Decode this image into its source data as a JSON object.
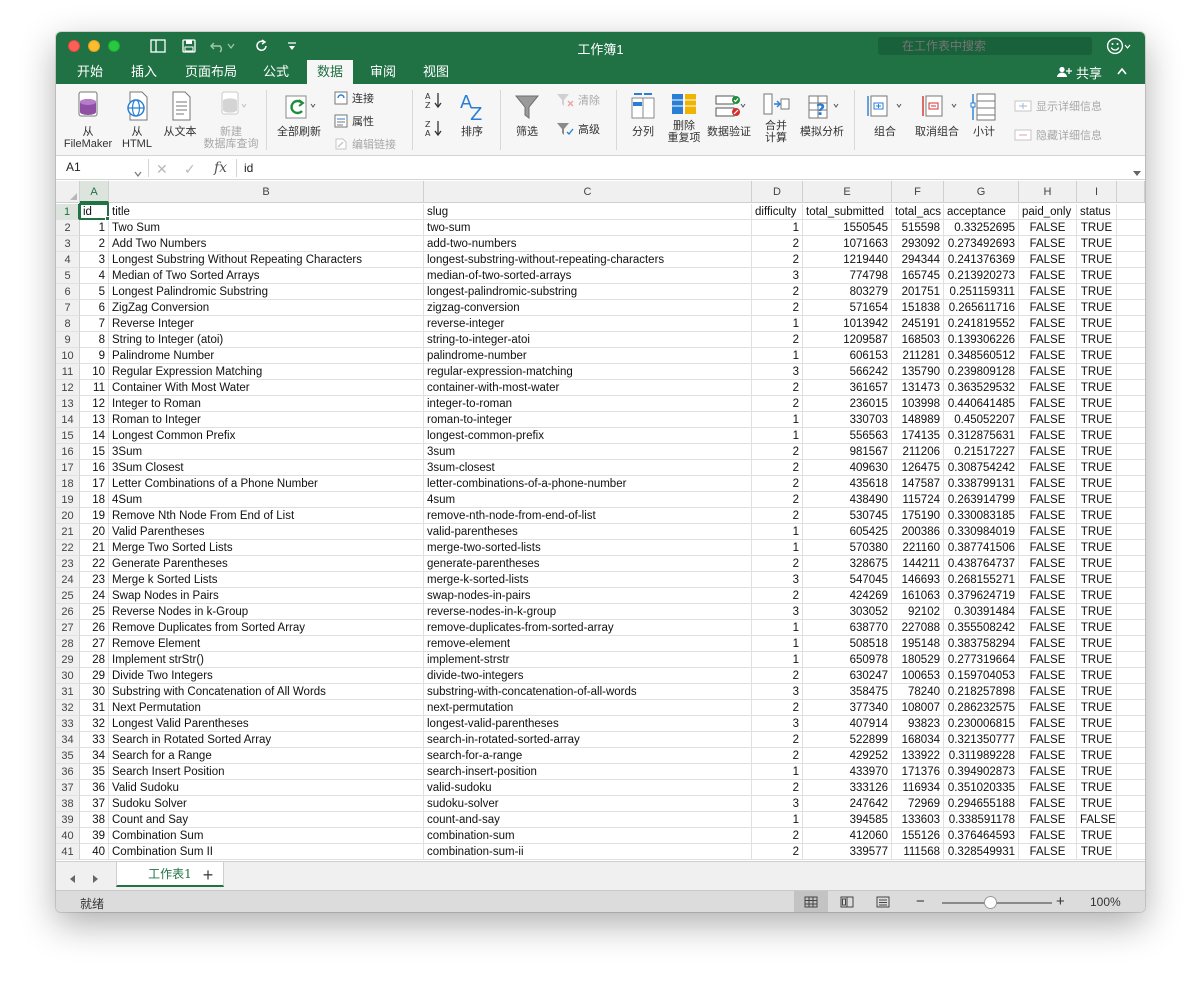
{
  "window": {
    "title": "工作簿1"
  },
  "search": {
    "placeholder": "在工作表中搜索"
  },
  "ribbon_tabs": [
    "开始",
    "插入",
    "页面布局",
    "公式",
    "数据",
    "审阅",
    "视图"
  ],
  "active_tab": "数据",
  "share_label": "共享",
  "ribbon": {
    "from_filemaker": "从\nFileMaker",
    "from_html": "从\nHTML",
    "from_text": "从文本",
    "new_db_query": "新建\n数据库查询",
    "refresh_all": "全部刷新",
    "connections": "连接",
    "properties": "属性",
    "edit_links": "编辑链接",
    "sort_az": "A↓Z",
    "sort_za": "Z↓A",
    "sort": "排序",
    "filter": "筛选",
    "clear": "清除",
    "advanced": "高级",
    "text_to_columns": "分列",
    "remove_duplicates": "删除\n重复项",
    "data_validation": "数据验证",
    "consolidate": "合并\n计算",
    "what_if": "模拟分析",
    "group": "组合",
    "ungroup": "取消组合",
    "subtotal": "小计",
    "show_detail": "显示详细信息",
    "hide_detail": "隐藏详细信息"
  },
  "formula_bar": {
    "name_box": "A1",
    "fx": "fx",
    "content": "id"
  },
  "columns": [
    {
      "letter": "A"
    },
    {
      "letter": "B"
    },
    {
      "letter": "C"
    },
    {
      "letter": "D"
    },
    {
      "letter": "E"
    },
    {
      "letter": "F"
    },
    {
      "letter": "G"
    },
    {
      "letter": "H"
    },
    {
      "letter": "I"
    }
  ],
  "header_row": [
    "id",
    "title",
    "slug",
    "difficulty",
    "total_submitted",
    "total_acs",
    "acceptance",
    "paid_only",
    "status"
  ],
  "rows": [
    [
      "1",
      "Two Sum",
      "two-sum",
      "1",
      "1550545",
      "515598",
      "0.33252695",
      "FALSE",
      "TRUE"
    ],
    [
      "2",
      "Add Two Numbers",
      "add-two-numbers",
      "2",
      "1071663",
      "293092",
      "0.273492693",
      "FALSE",
      "TRUE"
    ],
    [
      "3",
      "Longest Substring Without Repeating Characters",
      "longest-substring-without-repeating-characters",
      "2",
      "1219440",
      "294344",
      "0.241376369",
      "FALSE",
      "TRUE"
    ],
    [
      "4",
      "Median of Two Sorted Arrays",
      "median-of-two-sorted-arrays",
      "3",
      "774798",
      "165745",
      "0.213920273",
      "FALSE",
      "TRUE"
    ],
    [
      "5",
      "Longest Palindromic Substring",
      "longest-palindromic-substring",
      "2",
      "803279",
      "201751",
      "0.251159311",
      "FALSE",
      "TRUE"
    ],
    [
      "6",
      "ZigZag Conversion",
      "zigzag-conversion",
      "2",
      "571654",
      "151838",
      "0.265611716",
      "FALSE",
      "TRUE"
    ],
    [
      "7",
      "Reverse Integer",
      "reverse-integer",
      "1",
      "1013942",
      "245191",
      "0.241819552",
      "FALSE",
      "TRUE"
    ],
    [
      "8",
      "String to Integer (atoi)",
      "string-to-integer-atoi",
      "2",
      "1209587",
      "168503",
      "0.139306226",
      "FALSE",
      "TRUE"
    ],
    [
      "9",
      "Palindrome Number",
      "palindrome-number",
      "1",
      "606153",
      "211281",
      "0.348560512",
      "FALSE",
      "TRUE"
    ],
    [
      "10",
      "Regular Expression Matching",
      "regular-expression-matching",
      "3",
      "566242",
      "135790",
      "0.239809128",
      "FALSE",
      "TRUE"
    ],
    [
      "11",
      "Container With Most Water",
      "container-with-most-water",
      "2",
      "361657",
      "131473",
      "0.363529532",
      "FALSE",
      "TRUE"
    ],
    [
      "12",
      "Integer to Roman",
      "integer-to-roman",
      "2",
      "236015",
      "103998",
      "0.440641485",
      "FALSE",
      "TRUE"
    ],
    [
      "13",
      "Roman to Integer",
      "roman-to-integer",
      "1",
      "330703",
      "148989",
      "0.45052207",
      "FALSE",
      "TRUE"
    ],
    [
      "14",
      "Longest Common Prefix",
      "longest-common-prefix",
      "1",
      "556563",
      "174135",
      "0.312875631",
      "FALSE",
      "TRUE"
    ],
    [
      "15",
      "3Sum",
      "3sum",
      "2",
      "981567",
      "211206",
      "0.21517227",
      "FALSE",
      "TRUE"
    ],
    [
      "16",
      "3Sum Closest",
      "3sum-closest",
      "2",
      "409630",
      "126475",
      "0.308754242",
      "FALSE",
      "TRUE"
    ],
    [
      "17",
      "Letter Combinations of a Phone Number",
      "letter-combinations-of-a-phone-number",
      "2",
      "435618",
      "147587",
      "0.338799131",
      "FALSE",
      "TRUE"
    ],
    [
      "18",
      "4Sum",
      "4sum",
      "2",
      "438490",
      "115724",
      "0.263914799",
      "FALSE",
      "TRUE"
    ],
    [
      "19",
      "Remove Nth Node From End of List",
      "remove-nth-node-from-end-of-list",
      "2",
      "530745",
      "175190",
      "0.330083185",
      "FALSE",
      "TRUE"
    ],
    [
      "20",
      "Valid Parentheses",
      "valid-parentheses",
      "1",
      "605425",
      "200386",
      "0.330984019",
      "FALSE",
      "TRUE"
    ],
    [
      "21",
      "Merge Two Sorted Lists",
      "merge-two-sorted-lists",
      "1",
      "570380",
      "221160",
      "0.387741506",
      "FALSE",
      "TRUE"
    ],
    [
      "22",
      "Generate Parentheses",
      "generate-parentheses",
      "2",
      "328675",
      "144211",
      "0.438764737",
      "FALSE",
      "TRUE"
    ],
    [
      "23",
      "Merge k Sorted Lists",
      "merge-k-sorted-lists",
      "3",
      "547045",
      "146693",
      "0.268155271",
      "FALSE",
      "TRUE"
    ],
    [
      "24",
      "Swap Nodes in Pairs",
      "swap-nodes-in-pairs",
      "2",
      "424269",
      "161063",
      "0.379624719",
      "FALSE",
      "TRUE"
    ],
    [
      "25",
      "Reverse Nodes in k-Group",
      "reverse-nodes-in-k-group",
      "3",
      "303052",
      "92102",
      "0.30391484",
      "FALSE",
      "TRUE"
    ],
    [
      "26",
      "Remove Duplicates from Sorted Array",
      "remove-duplicates-from-sorted-array",
      "1",
      "638770",
      "227088",
      "0.355508242",
      "FALSE",
      "TRUE"
    ],
    [
      "27",
      "Remove Element",
      "remove-element",
      "1",
      "508518",
      "195148",
      "0.383758294",
      "FALSE",
      "TRUE"
    ],
    [
      "28",
      "Implement strStr()",
      "implement-strstr",
      "1",
      "650978",
      "180529",
      "0.277319664",
      "FALSE",
      "TRUE"
    ],
    [
      "29",
      "Divide Two Integers",
      "divide-two-integers",
      "2",
      "630247",
      "100653",
      "0.159704053",
      "FALSE",
      "TRUE"
    ],
    [
      "30",
      "Substring with Concatenation of All Words",
      "substring-with-concatenation-of-all-words",
      "3",
      "358475",
      "78240",
      "0.218257898",
      "FALSE",
      "TRUE"
    ],
    [
      "31",
      "Next Permutation",
      "next-permutation",
      "2",
      "377340",
      "108007",
      "0.286232575",
      "FALSE",
      "TRUE"
    ],
    [
      "32",
      "Longest Valid Parentheses",
      "longest-valid-parentheses",
      "3",
      "407914",
      "93823",
      "0.230006815",
      "FALSE",
      "TRUE"
    ],
    [
      "33",
      "Search in Rotated Sorted Array",
      "search-in-rotated-sorted-array",
      "2",
      "522899",
      "168034",
      "0.321350777",
      "FALSE",
      "TRUE"
    ],
    [
      "34",
      "Search for a Range",
      "search-for-a-range",
      "2",
      "429252",
      "133922",
      "0.311989228",
      "FALSE",
      "TRUE"
    ],
    [
      "35",
      "Search Insert Position",
      "search-insert-position",
      "1",
      "433970",
      "171376",
      "0.394902873",
      "FALSE",
      "TRUE"
    ],
    [
      "36",
      "Valid Sudoku",
      "valid-sudoku",
      "2",
      "333126",
      "116934",
      "0.351020335",
      "FALSE",
      "TRUE"
    ],
    [
      "37",
      "Sudoku Solver",
      "sudoku-solver",
      "3",
      "247642",
      "72969",
      "0.294655188",
      "FALSE",
      "TRUE"
    ],
    [
      "38",
      "Count and Say",
      "count-and-say",
      "1",
      "394585",
      "133603",
      "0.338591178",
      "FALSE",
      "FALSE"
    ],
    [
      "39",
      "Combination Sum",
      "combination-sum",
      "2",
      "412060",
      "155126",
      "0.376464593",
      "FALSE",
      "TRUE"
    ],
    [
      "40",
      "Combination Sum II",
      "combination-sum-ii",
      "2",
      "339577",
      "111568",
      "0.328549931",
      "FALSE",
      "TRUE"
    ]
  ],
  "sheet_tab": "工作表1",
  "status": {
    "ready": "就绪",
    "zoom": "100%",
    "zoom_level": 1.0
  }
}
